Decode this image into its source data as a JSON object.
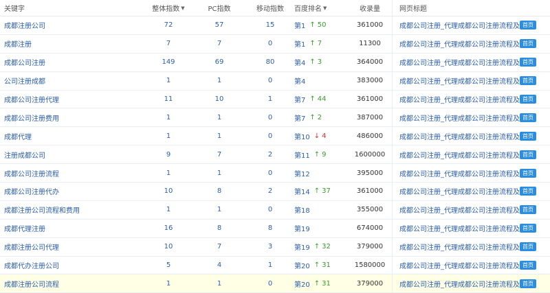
{
  "header": {
    "keyword": "关键字",
    "total": "整体指数",
    "pc": "PC指数",
    "mobile": "移动指数",
    "rank": "百度排名",
    "volume": "收录量",
    "title": "网页标题"
  },
  "rows": [
    {
      "kw": "成都注册公司",
      "total": "72",
      "pc": "57",
      "mob": "15",
      "rank": "第1",
      "dir": "up",
      "chg": "50",
      "vol": "361000",
      "title": "成都公司注册_代理成都公司注册流程及费用",
      "btn": "首页"
    },
    {
      "kw": "成都注册",
      "total": "7",
      "pc": "7",
      "mob": "0",
      "rank": "第1",
      "dir": "up",
      "chg": "7",
      "vol": "11300",
      "title": "成都公司注册_代理成都公司注册流程及费用",
      "btn": "首页"
    },
    {
      "kw": "成都公司注册",
      "total": "149",
      "pc": "69",
      "mob": "80",
      "rank": "第4",
      "dir": "up",
      "chg": "3",
      "vol": "364000",
      "title": "成都公司注册_代理成都公司注册流程及费用",
      "btn": "首页"
    },
    {
      "kw": "公司注册成都",
      "total": "1",
      "pc": "1",
      "mob": "0",
      "rank": "第4",
      "dir": "",
      "chg": "",
      "vol": "383000",
      "title": "成都公司注册_代理成都公司注册流程及费用",
      "btn": "首页"
    },
    {
      "kw": "成都公司注册代理",
      "total": "11",
      "pc": "10",
      "mob": "1",
      "rank": "第7",
      "dir": "up",
      "chg": "44",
      "vol": "361000",
      "title": "成都公司注册_代理成都公司注册流程及费用",
      "btn": "首页"
    },
    {
      "kw": "成都公司注册费用",
      "total": "1",
      "pc": "1",
      "mob": "0",
      "rank": "第7",
      "dir": "up",
      "chg": "2",
      "vol": "387000",
      "title": "成都公司注册_代理成都公司注册流程及费用",
      "btn": "首页"
    },
    {
      "kw": "成都代理",
      "total": "1",
      "pc": "1",
      "mob": "0",
      "rank": "第10",
      "dir": "down",
      "chg": "4",
      "vol": "486000",
      "title": "成都公司注册_代理成都公司注册流程及费用",
      "btn": "首页"
    },
    {
      "kw": "注册成都公司",
      "total": "9",
      "pc": "7",
      "mob": "2",
      "rank": "第11",
      "dir": "up",
      "chg": "9",
      "vol": "1600000",
      "title": "成都公司注册_代理成都公司注册流程及费用",
      "btn": "首页"
    },
    {
      "kw": "成都公司注册流程",
      "total": "1",
      "pc": "1",
      "mob": "0",
      "rank": "第12",
      "dir": "",
      "chg": "",
      "vol": "395000",
      "title": "成都公司注册_代理成都公司注册流程及费用",
      "btn": "首页"
    },
    {
      "kw": "成都公司注册代办",
      "total": "10",
      "pc": "8",
      "mob": "2",
      "rank": "第14",
      "dir": "up",
      "chg": "37",
      "vol": "361000",
      "title": "成都公司注册_代理成都公司注册流程及费用",
      "btn": "首页"
    },
    {
      "kw": "成都注册公司流程和费用",
      "total": "1",
      "pc": "1",
      "mob": "0",
      "rank": "第18",
      "dir": "",
      "chg": "",
      "vol": "355000",
      "title": "成都公司注册_代理成都公司注册流程及费用",
      "btn": "首页"
    },
    {
      "kw": "成都代理注册",
      "total": "16",
      "pc": "8",
      "mob": "8",
      "rank": "第19",
      "dir": "",
      "chg": "",
      "vol": "674000",
      "title": "成都公司注册_代理成都公司注册流程及费用",
      "btn": "首页"
    },
    {
      "kw": "成都注册公司代理",
      "total": "10",
      "pc": "7",
      "mob": "3",
      "rank": "第19",
      "dir": "up",
      "chg": "32",
      "vol": "379000",
      "title": "成都公司注册_代理成都公司注册流程及费用",
      "btn": "首页"
    },
    {
      "kw": "成都代办注册公司",
      "total": "5",
      "pc": "4",
      "mob": "1",
      "rank": "第20",
      "dir": "up",
      "chg": "31",
      "vol": "1580000",
      "title": "成都公司注册_代理成都公司注册流程及费用",
      "btn": "首页"
    },
    {
      "kw": "成都注册公司流程",
      "total": "1",
      "pc": "1",
      "mob": "0",
      "rank": "第20",
      "dir": "up",
      "chg": "31",
      "vol": "379000",
      "title": "成都公司注册_代理成都公司注册流程及费用",
      "btn": "首页"
    }
  ]
}
